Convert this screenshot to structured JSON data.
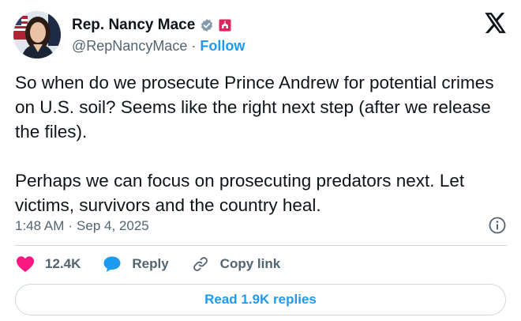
{
  "author": {
    "display_name": "Rep. Nancy Mace",
    "handle": "@RepNancyMace",
    "separator": "·",
    "follow_label": "Follow"
  },
  "tweet": {
    "paragraph_1": "So when do we prosecute Prince Andrew for potential crimes on U.S. soil? Seems like the right next step (after we release the files).",
    "paragraph_2": "Perhaps we can focus on prosecuting predators next. Let victims, survivors and the country heal.",
    "time": "1:48 AM",
    "separator": "·",
    "date": "Sep 4, 2025"
  },
  "actions": {
    "likes": "12.4K",
    "reply_label": "Reply",
    "copy_link_label": "Copy link"
  },
  "read_replies_label": "Read 1.9K replies",
  "colors": {
    "accent": "#1d9bf0",
    "like_red": "#f91880",
    "secondary_text": "#536471",
    "border": "#cfd9de"
  },
  "icons": [
    "verified-badge-icon",
    "government-affiliation-icon",
    "x-logo-icon",
    "info-icon",
    "heart-icon",
    "reply-bubble-icon",
    "link-icon"
  ]
}
